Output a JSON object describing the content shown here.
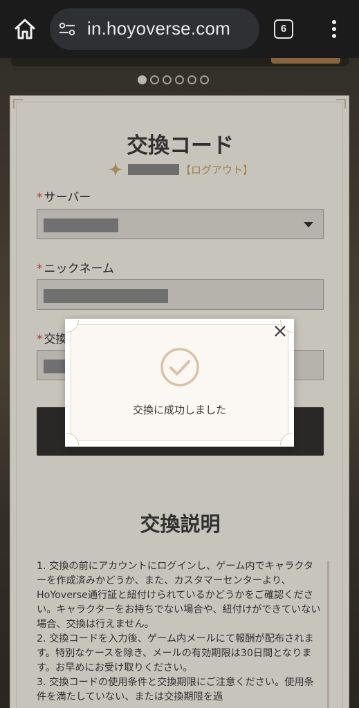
{
  "browser": {
    "url": "in.hoyoverse.com",
    "tab_count": "6",
    "icons": [
      "home-icon",
      "site-settings-icon",
      "more-vert-icon"
    ]
  },
  "carousel": {
    "dot_count": 6,
    "active_index": 0
  },
  "form": {
    "title": "交換コード",
    "logout_label": "【ログアウト】",
    "required_mark": "*",
    "server_label": "サーバー",
    "nickname_label": "ニックネーム",
    "code_label": "交換"
  },
  "dialog": {
    "message": "交換に成功しました"
  },
  "explanation": {
    "title": "交換説明",
    "paragraphs": [
      "1. 交換の前にアカウントにログインし、ゲーム内でキャラクターを作成済みかどうか、また、カスタマーセンターより、HoYoverse通行証と紐付けられているかどうかをご確認ください。キャラクターをお持ちでない場合や、紐付けができていない場合、交換は行えません。",
      "2. 交換コードを入力後、ゲーム内メールにて報酬が配布されます。特別なケースを除き、メールの有効期限は30日間となります。お早めにお受け取りください。",
      "3. 交換コードの使用条件と交換期限にご注意ください。使用条件を満たしていない、または交換期限を過"
    ]
  },
  "colors": {
    "accent_gold": "#c39a57",
    "required_red": "#d2452f",
    "button_dark": "#33312f"
  }
}
